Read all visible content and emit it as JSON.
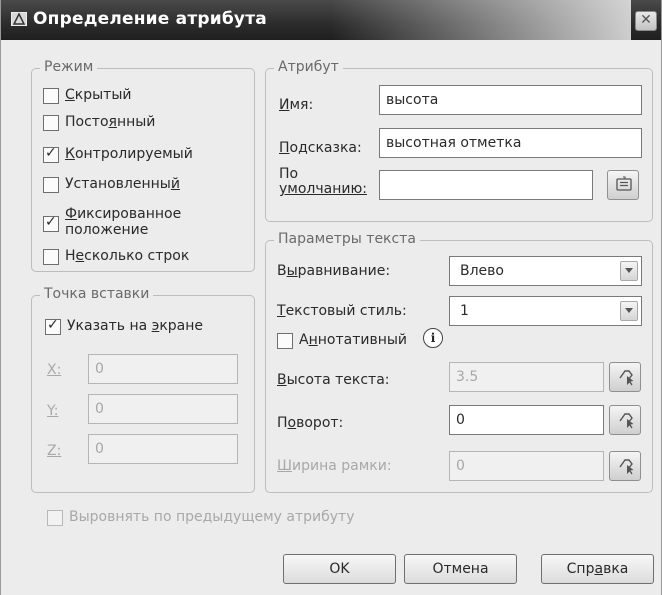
{
  "title": "Определение атрибута",
  "close_glyph": "✕",
  "mode": {
    "legend": "Режим",
    "items": [
      {
        "pre": "",
        "u": "С",
        "post": "крытый",
        "checked": false
      },
      {
        "pre": "Посто",
        "u": "я",
        "post": "нный",
        "checked": false
      },
      {
        "pre": "",
        "u": "К",
        "post": "онтролируемый",
        "checked": true
      },
      {
        "pre": "Установленны",
        "u": "й",
        "post": "",
        "checked": false
      },
      {
        "pre": "",
        "u": "Ф",
        "post": "иксированное",
        "line2": "положение",
        "checked": true
      },
      {
        "pre": "Н",
        "u": "е",
        "post": "сколько строк",
        "checked": false
      }
    ]
  },
  "insertion": {
    "legend": "Точка вставки",
    "specify": {
      "pre": "Указать на ",
      "u": "э",
      "post": "кране",
      "checked": true
    },
    "x_label": "X:",
    "x_value": "0",
    "y_label": "Y:",
    "y_value": "0",
    "z_label": "Z:",
    "z_value": "0"
  },
  "attribute": {
    "legend": "Атрибут",
    "tag_label_pre": "",
    "tag_label_u": "И",
    "tag_label_post": "мя:",
    "tag_value": "высота",
    "prompt_label_pre": "",
    "prompt_label_u": "П",
    "prompt_label_post": "одсказка:",
    "prompt_value": "высотная отметка",
    "default_label_line1": "По",
    "default_label_line2": "умолчанию:",
    "default_value": ""
  },
  "text_settings": {
    "legend": "Параметры текста",
    "justify_label": "Выравнивание:",
    "justify_value": "Влево",
    "style_label": "Текстовый стиль:",
    "style_value": "1",
    "annotative_label": "Аннотативный",
    "annotative_checked": false,
    "height_label": "Высота текста:",
    "height_value": "3.5",
    "rotation_label": "Поворот:",
    "rotation_value": "0",
    "width_label": "Ширина рамки:",
    "width_value": "0"
  },
  "align_below": {
    "label": "Выровнять по предыдущему атрибуту",
    "checked": false
  },
  "buttons": {
    "ok": "OK",
    "cancel": "Отмена",
    "help_pre": "Спр",
    "help_u": "а",
    "help_post": "вка"
  }
}
